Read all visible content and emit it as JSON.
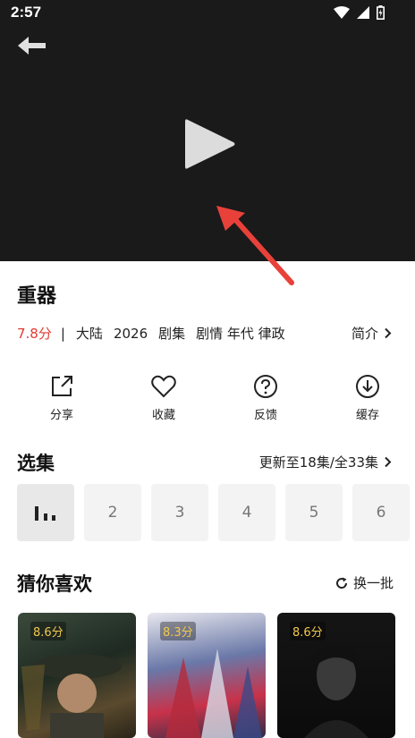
{
  "status_bar": {
    "time": "2:57"
  },
  "video": {
    "title": "重器"
  },
  "meta": {
    "score": "7.8分",
    "separator": "|",
    "region": "大陆",
    "year": "2026",
    "type": "剧集",
    "genres": "剧情 年代 律政",
    "intro_label": "简介"
  },
  "actions": [
    {
      "label": "分享",
      "icon": "share-icon"
    },
    {
      "label": "收藏",
      "icon": "heart-icon"
    },
    {
      "label": "反馈",
      "icon": "question-icon"
    },
    {
      "label": "缓存",
      "icon": "download-icon"
    }
  ],
  "episodes_section": {
    "title": "选集",
    "update_info": "更新至18集/全33集",
    "items": [
      "2",
      "3",
      "4",
      "5",
      "6"
    ]
  },
  "recommend_section": {
    "title": "猜你喜欢",
    "refresh_label": "换一批",
    "cards": [
      {
        "rating": "8.6分"
      },
      {
        "rating": "8.3分"
      },
      {
        "rating": "8.6分"
      }
    ]
  },
  "colors": {
    "score_red": "#e23a32",
    "rating_yellow": "#f2c94c",
    "arrow_red": "#e8413a"
  }
}
